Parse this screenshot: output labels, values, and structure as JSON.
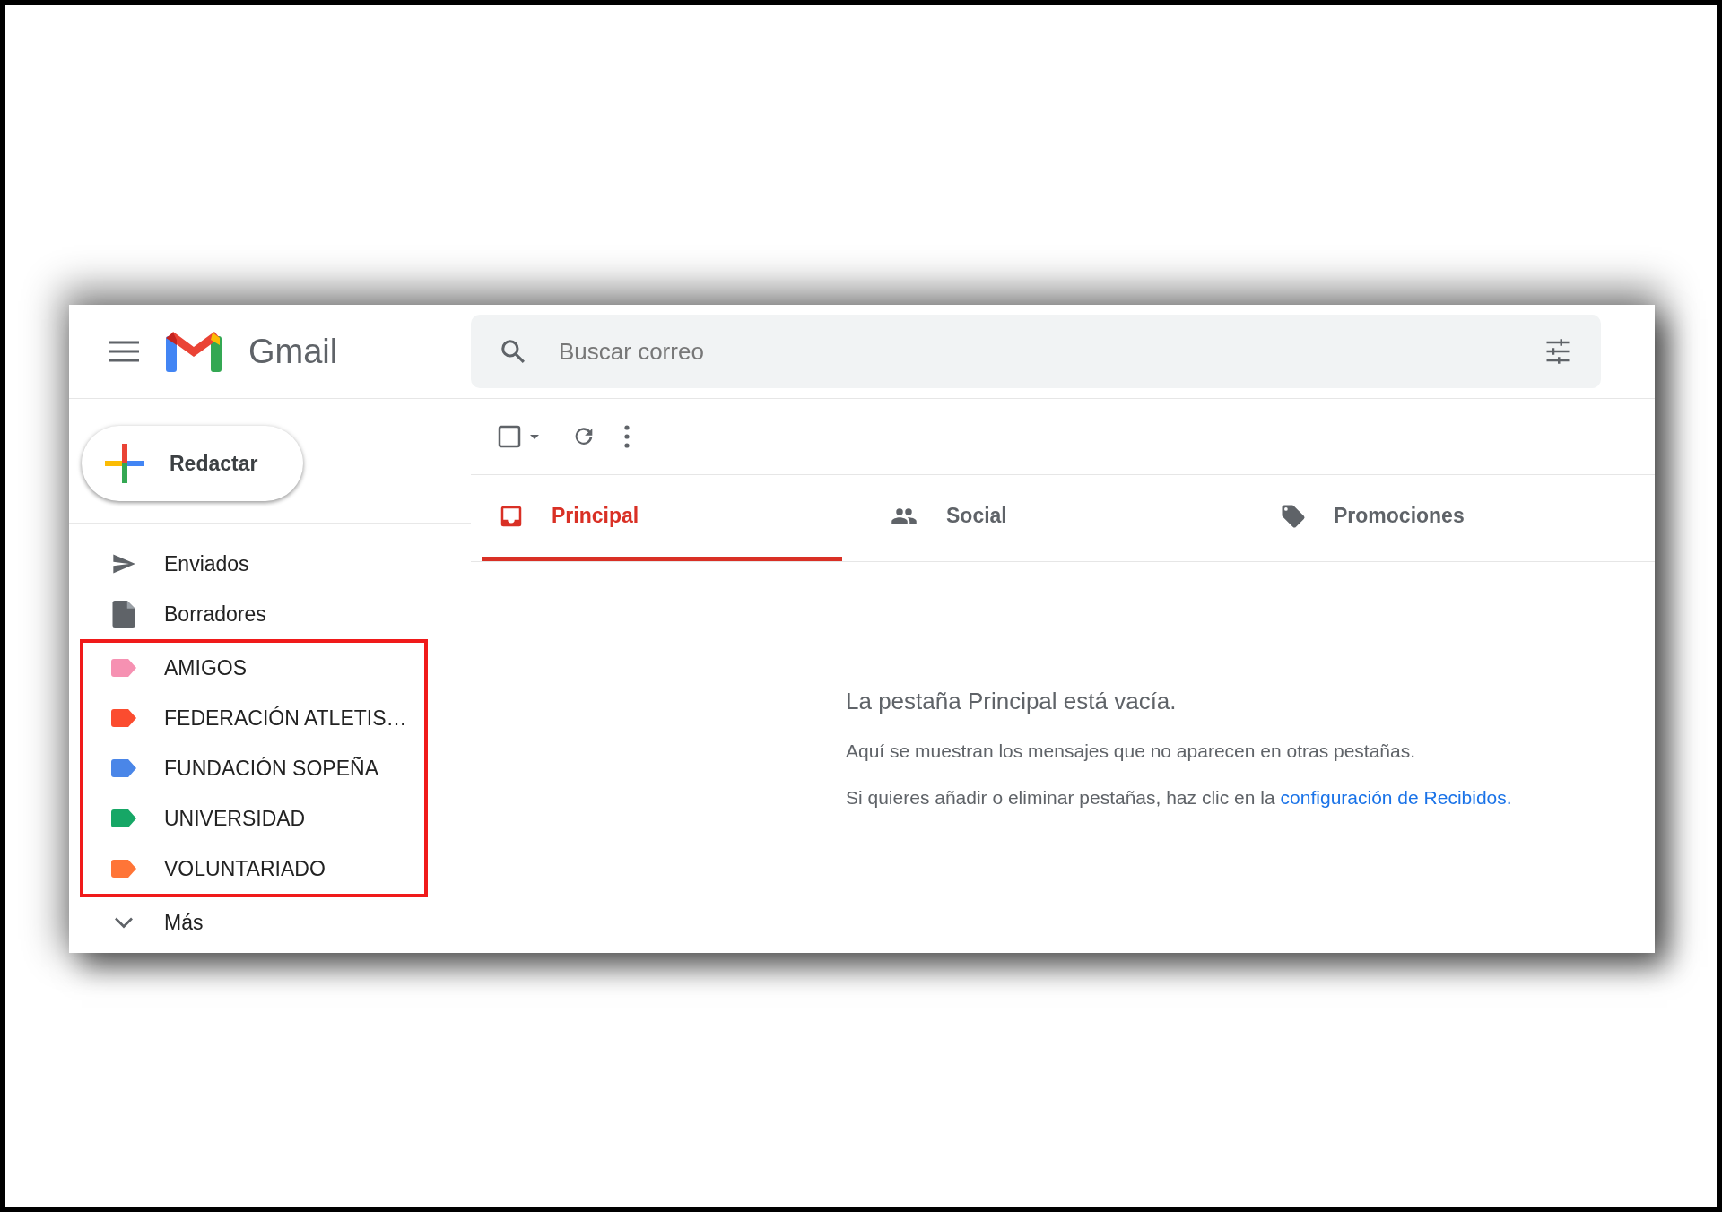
{
  "header": {
    "app_name": "Gmail",
    "search": {
      "placeholder": "Buscar correo"
    }
  },
  "compose": {
    "label": "Redactar"
  },
  "sidebar": {
    "items": [
      {
        "kind": "sent",
        "label": "Enviados"
      },
      {
        "kind": "drafts",
        "label": "Borradores"
      }
    ],
    "labels": [
      {
        "label": "AMIGOS",
        "color": "#f691b2"
      },
      {
        "label": "FEDERACIÓN ATLETIS…",
        "color": "#fb4c2f"
      },
      {
        "label": "FUNDACIÓN SOPEÑA",
        "color": "#4a86e8"
      },
      {
        "label": "UNIVERSIDAD",
        "color": "#16a766"
      },
      {
        "label": "VOLUNTARIADO",
        "color": "#ff7537"
      }
    ],
    "more": {
      "label": "Más"
    }
  },
  "tabs": [
    {
      "kind": "inbox",
      "label": "Principal",
      "selected": true
    },
    {
      "kind": "people",
      "label": "Social",
      "selected": false
    },
    {
      "kind": "tag",
      "label": "Promociones",
      "selected": false
    }
  ],
  "empty_state": {
    "title": "La pestaña Principal está vacía.",
    "line": "Aquí se muestran los mensajes que no aparecen en otras pestañas.",
    "hint": "Si quieres añadir o eliminar pestañas, haz clic en la",
    "link": "configuración de Recibidos."
  }
}
